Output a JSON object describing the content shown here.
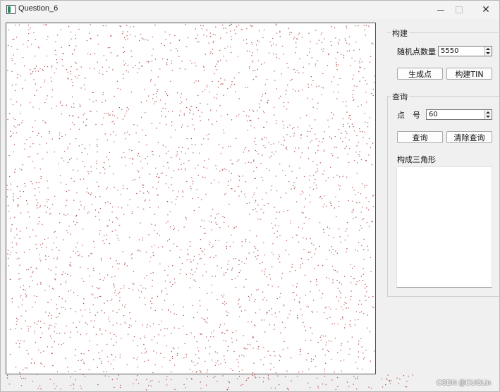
{
  "window": {
    "title": "Question_6"
  },
  "build": {
    "group_title": "构建",
    "count_label": "随机点数量",
    "count_value": "5550",
    "generate_label": "生成点",
    "build_tin_label": "构建TIN"
  },
  "query": {
    "group_title": "查询",
    "point_label": "点　号",
    "point_value": "60",
    "query_label": "查询",
    "clear_label": "清除查询",
    "triangles_label": "构成三角形"
  },
  "watermark": "CSDN @CUGLin",
  "colors": {
    "point": "#b05050",
    "canvas": "#ffffff",
    "border": "#555555"
  }
}
